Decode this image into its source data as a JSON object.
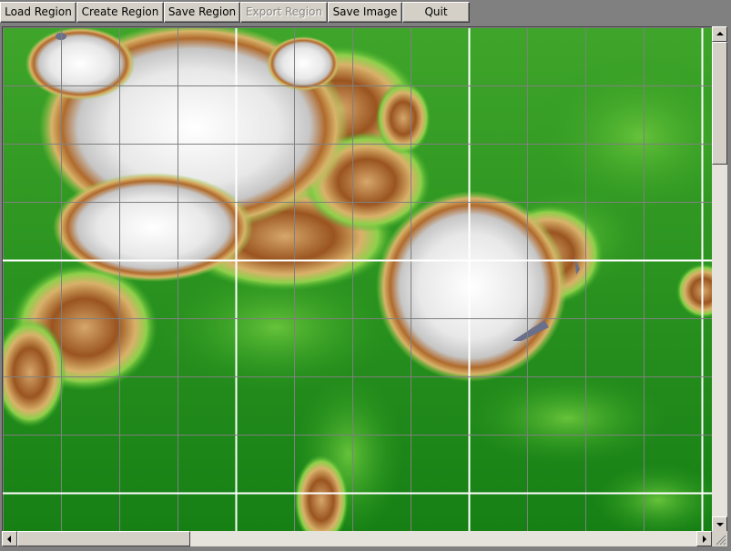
{
  "toolbar": {
    "buttons": [
      {
        "label": "Load Region",
        "enabled": true
      },
      {
        "label": "Create Region",
        "enabled": true
      },
      {
        "label": "Save Region",
        "enabled": true
      },
      {
        "label": "Export Region",
        "enabled": false
      },
      {
        "label": "Save Image",
        "enabled": true
      },
      {
        "label": "Quit",
        "enabled": true
      }
    ]
  },
  "map": {
    "colors": {
      "lowland": "#1d8a16",
      "grass": "#3fae2a",
      "lightgrass": "#8ed04a",
      "sand": "#d9b16a",
      "rock": "#9a5420",
      "snow": "#f2f2f2",
      "snowshade": "#c9c9c9",
      "water": "#6a6f8a",
      "grid_minor": "#808080",
      "grid_major": "#ffffff"
    }
  },
  "scrollbars": {
    "vertical": {
      "position": 0.0
    },
    "horizontal": {
      "position": 0.0
    }
  }
}
